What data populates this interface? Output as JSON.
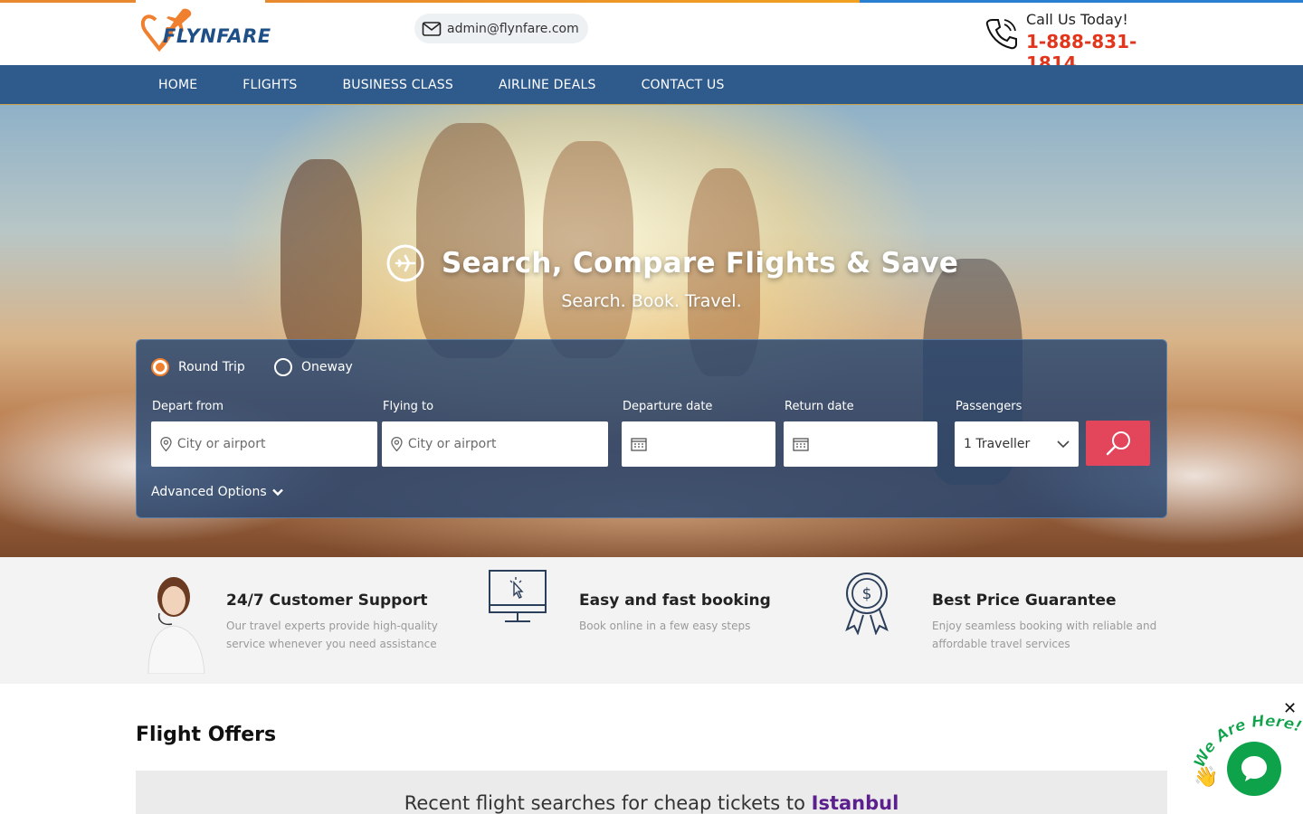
{
  "header": {
    "logo_text": "FLYNFARE",
    "email": "admin@flynfare.com",
    "call_title": "Call Us Today!",
    "call_number": "1-888-831-1814"
  },
  "nav": {
    "items": [
      "HOME",
      "FLIGHTS",
      "BUSINESS CLASS",
      "AIRLINE DEALS",
      "CONTACT US"
    ]
  },
  "hero": {
    "title": "Search, Compare Flights & Save",
    "subtitle": "Search. Book. Travel."
  },
  "search": {
    "trip_types": [
      {
        "label": "Round Trip",
        "selected": true
      },
      {
        "label": "Oneway",
        "selected": false
      }
    ],
    "depart_label": "Depart from",
    "depart_placeholder": "City or airport",
    "flying_label": "Flying to",
    "flying_placeholder": "City or airport",
    "departure_date_label": "Departure date",
    "return_date_label": "Return date",
    "passengers_label": "Passengers",
    "passengers_value": "1 Traveller",
    "advanced_options": "Advanced Options"
  },
  "features": [
    {
      "title": "24/7 Customer Support",
      "desc": "Our travel experts provide high-quality service whenever you need assistance",
      "icon": "support-agent-icon"
    },
    {
      "title": "Easy and fast booking",
      "desc": "Book online in a few easy steps",
      "icon": "monitor-click-icon"
    },
    {
      "title": "Best Price Guarantee",
      "desc": "Enjoy seamless booking with reliable and affordable travel services",
      "icon": "price-badge-icon"
    }
  ],
  "offers": {
    "title": "Flight Offers",
    "recent_prefix": "Recent flight searches for cheap tickets to ",
    "recent_city": "Istanbul"
  },
  "chat": {
    "badge_text": "We Are Here!",
    "close": "✕"
  },
  "colors": {
    "nav_bg": "#2e5a8c",
    "accent_orange": "#f07f2e",
    "phone_red": "#e2361c",
    "search_btn": "#e3455a",
    "chat_green": "#0ea24a",
    "city_purple": "#5b1f8e"
  }
}
